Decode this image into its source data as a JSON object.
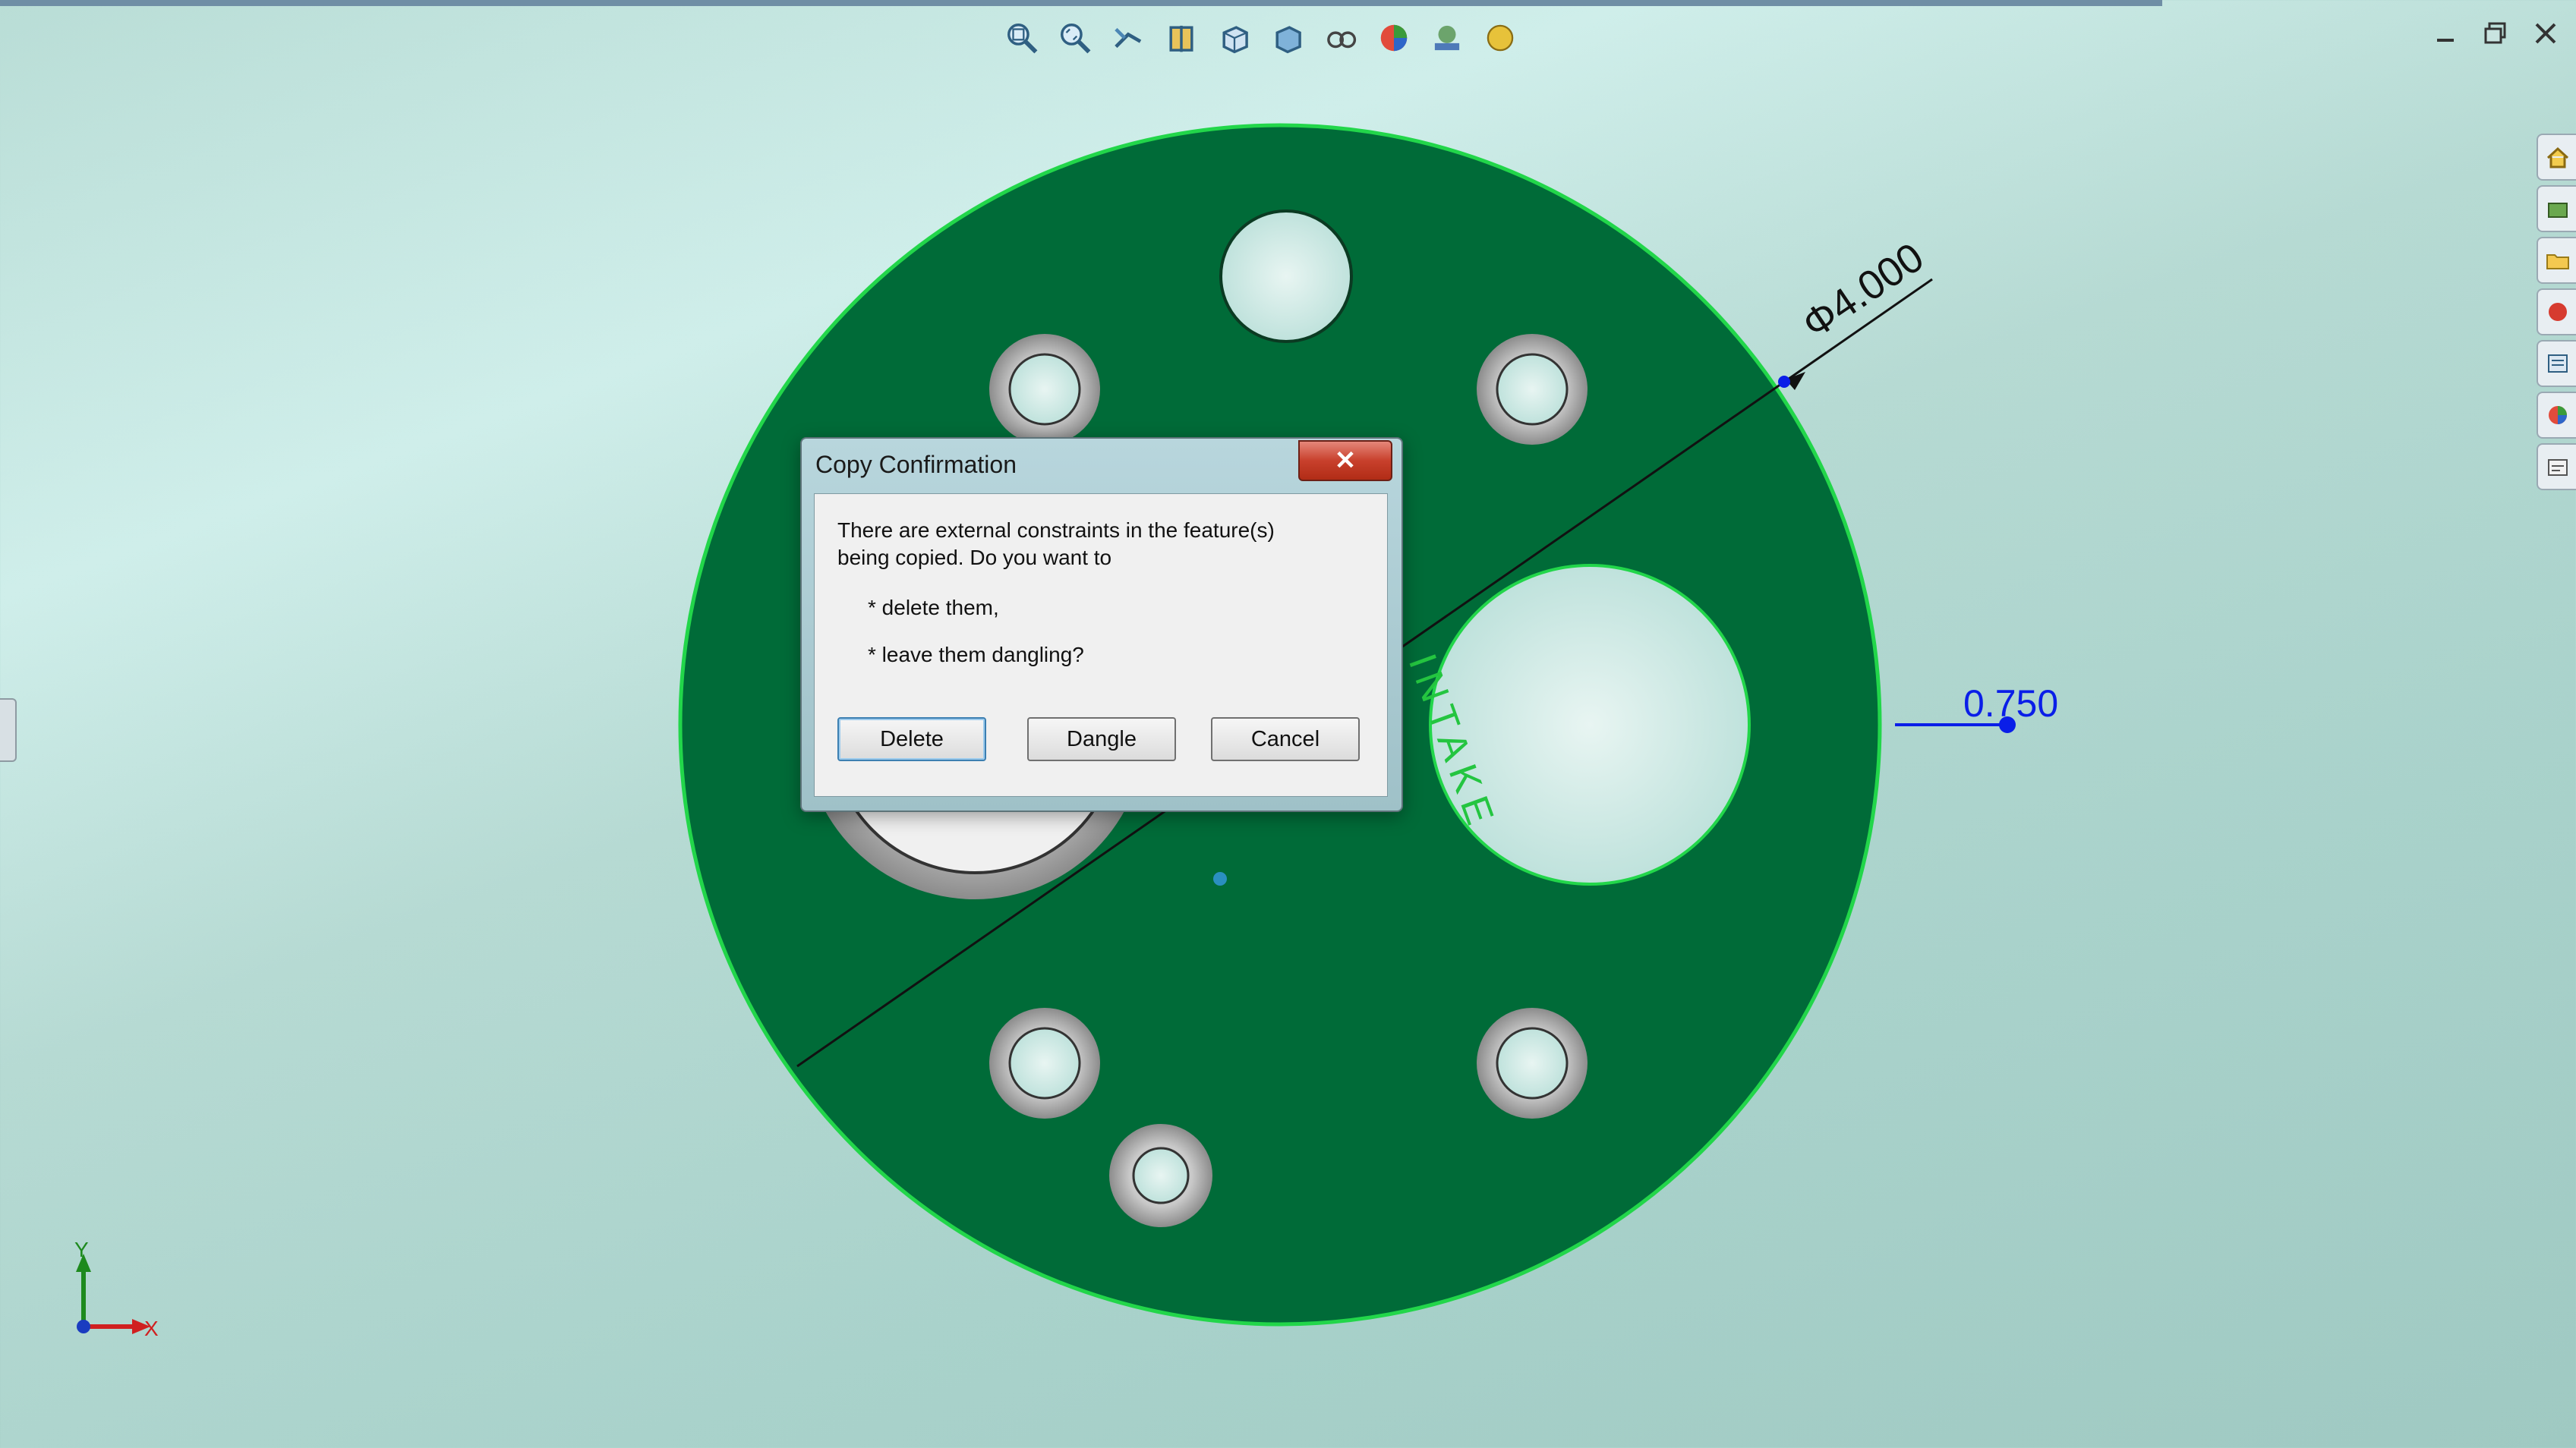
{
  "window": {
    "minimize_label": "minimize",
    "restore_label": "restore",
    "close_label": "close"
  },
  "toolbar": {
    "icons": [
      "zoom-to-fit-icon",
      "zoom-to-area-icon",
      "previous-view-icon",
      "section-view-icon",
      "view-orientation-icon",
      "display-style-icon",
      "hide-show-items-icon",
      "edit-appearance-icon",
      "apply-scene-icon",
      "view-settings-icon"
    ]
  },
  "side_panel": {
    "icons": [
      "home-icon",
      "resources-icon",
      "folder-icon",
      "design-library-icon",
      "file-explorer-icon",
      "appearances-icon",
      "custom-properties-icon"
    ]
  },
  "model": {
    "dimension_diameter": "Φ4.000",
    "dimension_linear": "0.750",
    "engraved_text": "INTAKE",
    "colors": {
      "face": "#006b38",
      "edge": "#22d64a",
      "dimension_blue": "#0a1ee8"
    }
  },
  "axes": {
    "x_label": "X",
    "y_label": "Y"
  },
  "dialog": {
    "title": "Copy Confirmation",
    "close_glyph": "✕",
    "message_line1": "There are external constraints in the feature(s)",
    "message_line2": "being copied.  Do you want to",
    "option1": "* delete them,",
    "option2": "* leave them dangling?",
    "buttons": {
      "delete": "Delete",
      "dangle": "Dangle",
      "cancel": "Cancel"
    }
  }
}
